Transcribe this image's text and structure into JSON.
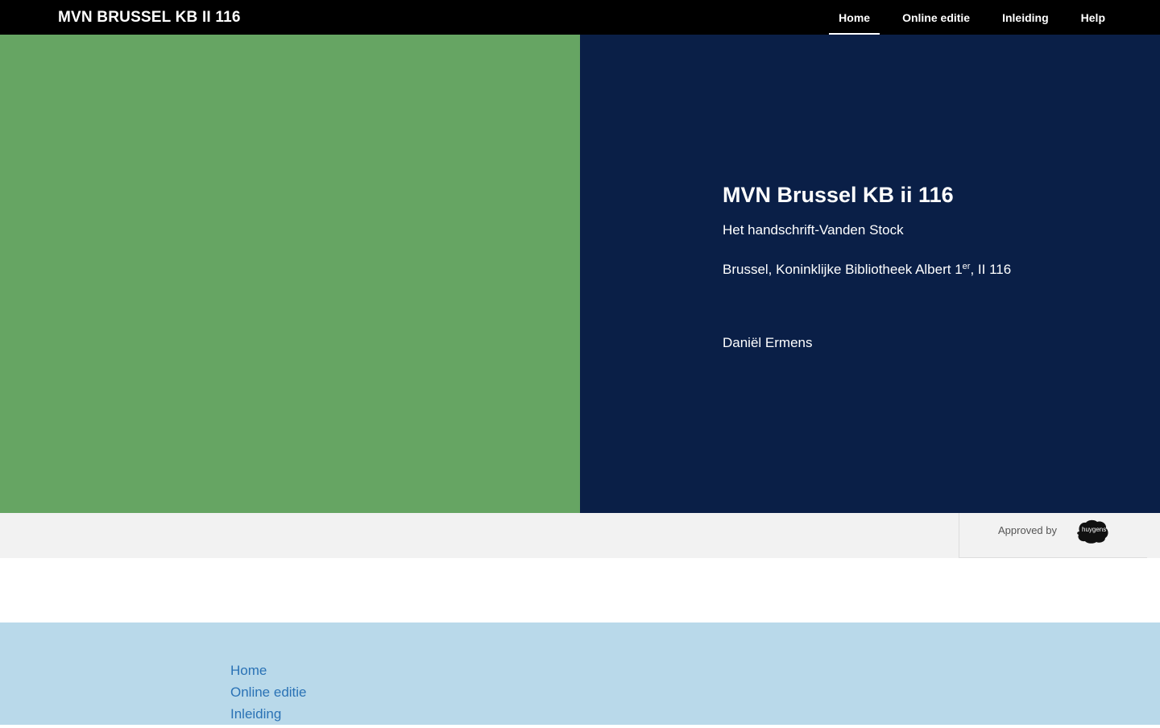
{
  "navbar": {
    "brand": "MVN BRUSSEL KB II 116",
    "items": [
      {
        "label": "Home",
        "active": true
      },
      {
        "label": "Online editie",
        "active": false
      },
      {
        "label": "Inleiding",
        "active": false
      },
      {
        "label": "Help",
        "active": false
      }
    ]
  },
  "hero": {
    "title": "MVN Brussel KB ii 116",
    "subtitle": "Het handschrift-Vanden Stock",
    "location_prefix": "Brussel, Koninklijke Bibliotheek Albert 1",
    "location_sup": "er",
    "location_suffix": ", II 116",
    "author": "Daniël Ermens",
    "colors": {
      "left_panel": "#66a563",
      "right_panel": "#0a1f47"
    }
  },
  "approved": {
    "text": "Approved by",
    "logo_icon": "huygens-logo-icon",
    "logo_text": "huygens ing"
  },
  "footer": {
    "links": [
      "Home",
      "Online editie",
      "Inleiding"
    ],
    "link_color": "#2a72b5",
    "background": "#b9d9ea"
  }
}
